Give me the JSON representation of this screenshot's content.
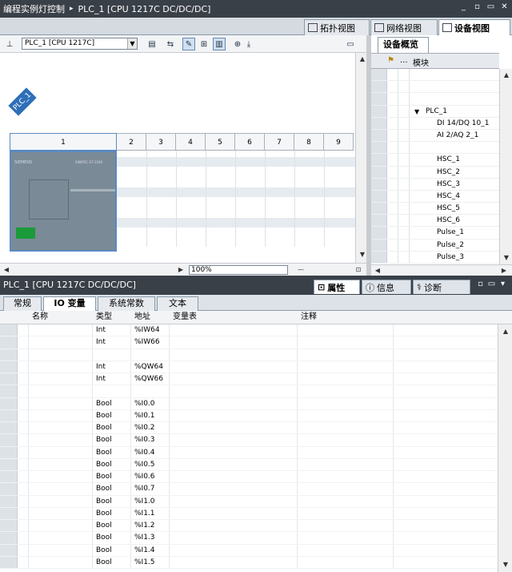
{
  "title": {
    "project": "编程实例灯控制",
    "device": "PLC_1 [CPU 1217C DC/DC/DC]",
    "sep": "▸"
  },
  "view_tabs": {
    "topology": "拓扑视图",
    "network": "网络视图",
    "device": "设备视图"
  },
  "toolbar": {
    "device_select": "PLC_1 [CPU 1217C]",
    "zoom": "100%"
  },
  "canvas": {
    "plc_badge": "PLC_1",
    "slots": [
      "1",
      "2",
      "3",
      "4",
      "5",
      "6",
      "7",
      "8",
      "9"
    ],
    "cpu_brand": "SIEMENS",
    "cpu_model": "SIMATIC S7-1200"
  },
  "overview": {
    "tab": "设备概览",
    "col_module": "模块",
    "col_dots": "...",
    "rows": [
      "",
      "",
      "",
      "PLC_1",
      "DI 14/DQ 10_1",
      "AI 2/AQ 2_1",
      "",
      "HSC_1",
      "HSC_2",
      "HSC_3",
      "HSC_4",
      "HSC_5",
      "HSC_6",
      "Pulse_1",
      "Pulse_2",
      "Pulse_3"
    ]
  },
  "properties": {
    "title": "PLC_1 [CPU 1217C DC/DC/DC]",
    "tab_props": "属性",
    "tab_info": "信息",
    "tab_diag": "诊断",
    "subtabs": [
      "常规",
      "IO 变量",
      "系统常数",
      "文本"
    ]
  },
  "io_table": {
    "headers": {
      "name": "名称",
      "type": "类型",
      "address": "地址",
      "table": "变量表",
      "comment": "注释"
    },
    "rows": [
      {
        "type": "Int",
        "addr": "%IW64"
      },
      {
        "type": "Int",
        "addr": "%IW66"
      },
      {
        "type": "",
        "addr": ""
      },
      {
        "type": "Int",
        "addr": "%QW64"
      },
      {
        "type": "Int",
        "addr": "%QW66"
      },
      {
        "type": "",
        "addr": ""
      },
      {
        "type": "Bool",
        "addr": "%I0.0"
      },
      {
        "type": "Bool",
        "addr": "%I0.1"
      },
      {
        "type": "Bool",
        "addr": "%I0.2"
      },
      {
        "type": "Bool",
        "addr": "%I0.3"
      },
      {
        "type": "Bool",
        "addr": "%I0.4"
      },
      {
        "type": "Bool",
        "addr": "%I0.5"
      },
      {
        "type": "Bool",
        "addr": "%I0.6"
      },
      {
        "type": "Bool",
        "addr": "%I0.7"
      },
      {
        "type": "Bool",
        "addr": "%I1.0"
      },
      {
        "type": "Bool",
        "addr": "%I1.1"
      },
      {
        "type": "Bool",
        "addr": "%I1.2"
      },
      {
        "type": "Bool",
        "addr": "%I1.3"
      },
      {
        "type": "Bool",
        "addr": "%I1.4"
      },
      {
        "type": "Bool",
        "addr": "%I1.5"
      }
    ]
  },
  "colors": {
    "titlebar": "#3a4048",
    "accent": "#2e6fb8",
    "terminal": "#1a9a3a"
  }
}
